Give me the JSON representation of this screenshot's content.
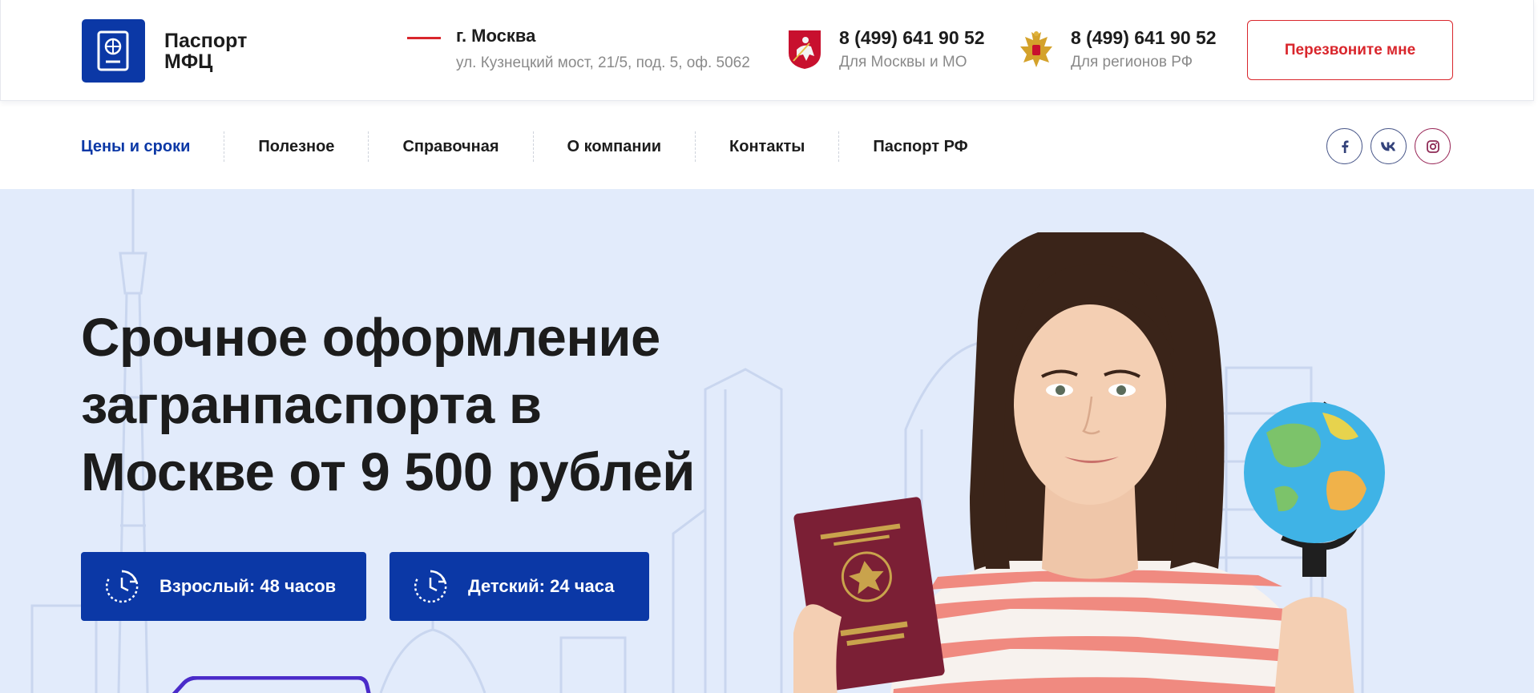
{
  "header": {
    "logo": {
      "line1": "Паспорт",
      "line2": "МФЦ"
    },
    "address": {
      "city": "г. Москва",
      "street": "ул. Кузнецкий мост, 21/5, под. 5, оф. 5062"
    },
    "phones": [
      {
        "number": "8 (499) 641 90 52",
        "caption": "Для Москвы и МО",
        "emblem": "moscow-coat-of-arms"
      },
      {
        "number": "8 (499) 641 90 52",
        "caption": "Для регионов РФ",
        "emblem": "russia-coat-of-arms"
      }
    ],
    "callback_label": "Перезвоните мне"
  },
  "nav": {
    "items": [
      {
        "label": "Цены и сроки",
        "active": true
      },
      {
        "label": "Полезное",
        "active": false
      },
      {
        "label": "Справочная",
        "active": false
      },
      {
        "label": "О компании",
        "active": false
      },
      {
        "label": "Контакты",
        "active": false
      },
      {
        "label": "Паспорт РФ",
        "active": false
      }
    ],
    "socials": [
      {
        "icon": "facebook-icon"
      },
      {
        "icon": "vk-icon"
      },
      {
        "icon": "instagram-icon"
      }
    ]
  },
  "hero": {
    "title_lines": [
      "Срочное оформление",
      "загранпаспорта в",
      "Москве от 9 500 рублей"
    ],
    "terms": [
      {
        "label": "Взрослый: 48 часов",
        "icon": "clock-icon"
      },
      {
        "label": "Детский: 24 часа",
        "icon": "clock-icon"
      }
    ],
    "image": "woman-holding-passport-and-globe"
  },
  "colors": {
    "brand_blue": "#0b38a6",
    "accent_red": "#d9262c",
    "hero_bg": "#e2ebfb",
    "text_dark": "#1c1c1c",
    "text_muted": "#8a8a8a"
  }
}
